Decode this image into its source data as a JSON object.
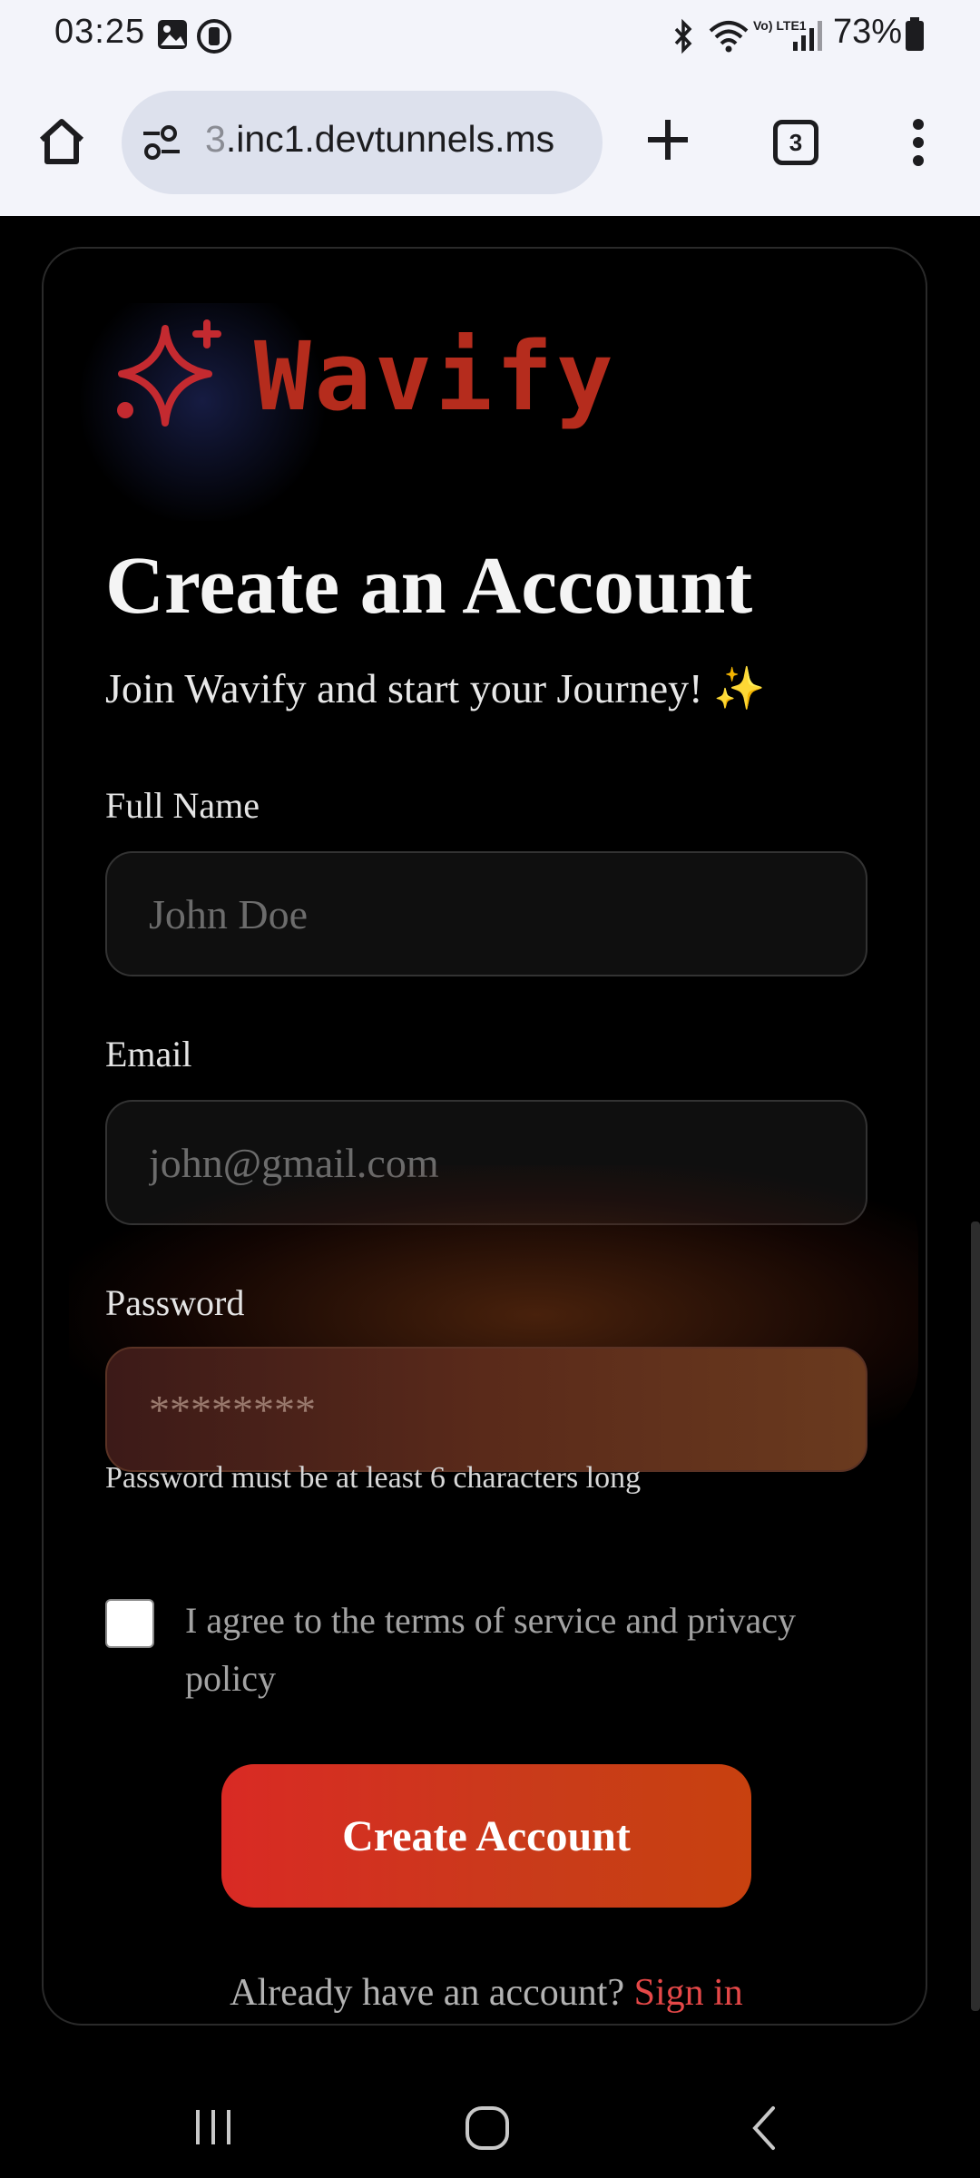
{
  "status_bar": {
    "time": "03:25",
    "battery": "73%",
    "network": "Vo) LTE1"
  },
  "browser": {
    "url_faded": "3",
    "url": ".inc1.devtunnels.ms",
    "tab_count": "3"
  },
  "brand": {
    "name": "Wavify",
    "color": "#b52c1d"
  },
  "form": {
    "title": "Create an Account",
    "subtitle": "Join Wavify and start your Journey! ✨",
    "full_name": {
      "label": "Full Name",
      "placeholder": "John Doe",
      "value": ""
    },
    "email": {
      "label": "Email",
      "placeholder": "john@gmail.com",
      "value": ""
    },
    "password": {
      "label": "Password",
      "placeholder": "********",
      "value": "",
      "hint": "Password must be at least 6 characters long"
    },
    "agree": {
      "label": "I agree to the terms of service and privacy policy",
      "checked": false
    },
    "submit_label": "Create Account",
    "signin_prompt": "Already have an account?",
    "signin_link": "Sign in"
  },
  "colors": {
    "accent": "#e54848",
    "button_start": "#d92a24",
    "button_end": "#c8410f"
  }
}
